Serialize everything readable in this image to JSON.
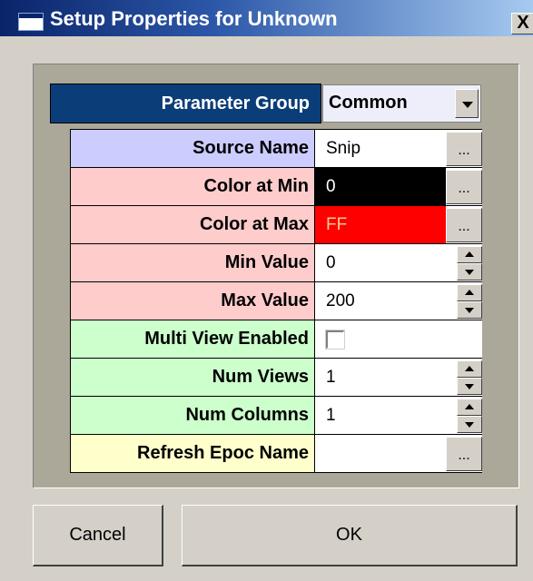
{
  "window": {
    "title": "Setup Properties for Unknown",
    "close_label": "X"
  },
  "parameter_group": {
    "label": "Parameter Group",
    "selected": "Common"
  },
  "properties": [
    {
      "label": "Source Name",
      "value": "Snip",
      "control": "ellipsis",
      "label_bg": "#ccccff",
      "value_bg": "#ffffff",
      "value_color": "#000000"
    },
    {
      "label": "Color at Min",
      "value": "0",
      "control": "ellipsis",
      "label_bg": "#ffcccc",
      "value_bg": "#000000",
      "value_color": "#ffffff"
    },
    {
      "label": "Color at Max",
      "value": "FF",
      "control": "ellipsis",
      "label_bg": "#ffcccc",
      "value_bg": "#ff0000",
      "value_color": "#ffcc99"
    },
    {
      "label": "Min Value",
      "value": "0",
      "control": "spinner",
      "label_bg": "#ffcccc",
      "value_bg": "#ffffff",
      "value_color": "#000000"
    },
    {
      "label": "Max Value",
      "value": "200",
      "control": "spinner",
      "label_bg": "#ffcccc",
      "value_bg": "#ffffff",
      "value_color": "#000000"
    },
    {
      "label": "Multi View Enabled",
      "value": "",
      "control": "checkbox",
      "label_bg": "#ccffcc",
      "value_bg": "#ffffff",
      "value_color": "#000000"
    },
    {
      "label": "Num Views",
      "value": "1",
      "control": "spinner",
      "label_bg": "#ccffcc",
      "value_bg": "#ffffff",
      "value_color": "#000000"
    },
    {
      "label": "Num Columns",
      "value": "1",
      "control": "spinner",
      "label_bg": "#ccffcc",
      "value_bg": "#ffffff",
      "value_color": "#000000"
    },
    {
      "label": "Refresh Epoc Name",
      "value": "",
      "control": "ellipsis",
      "label_bg": "#ffffcc",
      "value_bg": "#ffffff",
      "value_color": "#000000"
    }
  ],
  "ellipsis_label": "...",
  "buttons": {
    "cancel": "Cancel",
    "ok": "OK"
  },
  "colors": {
    "titlebar": "#0a246a",
    "group_label_bg": "#0b3d78",
    "dialog_bg": "#d4d0c8",
    "panel_bg": "#aca899"
  }
}
